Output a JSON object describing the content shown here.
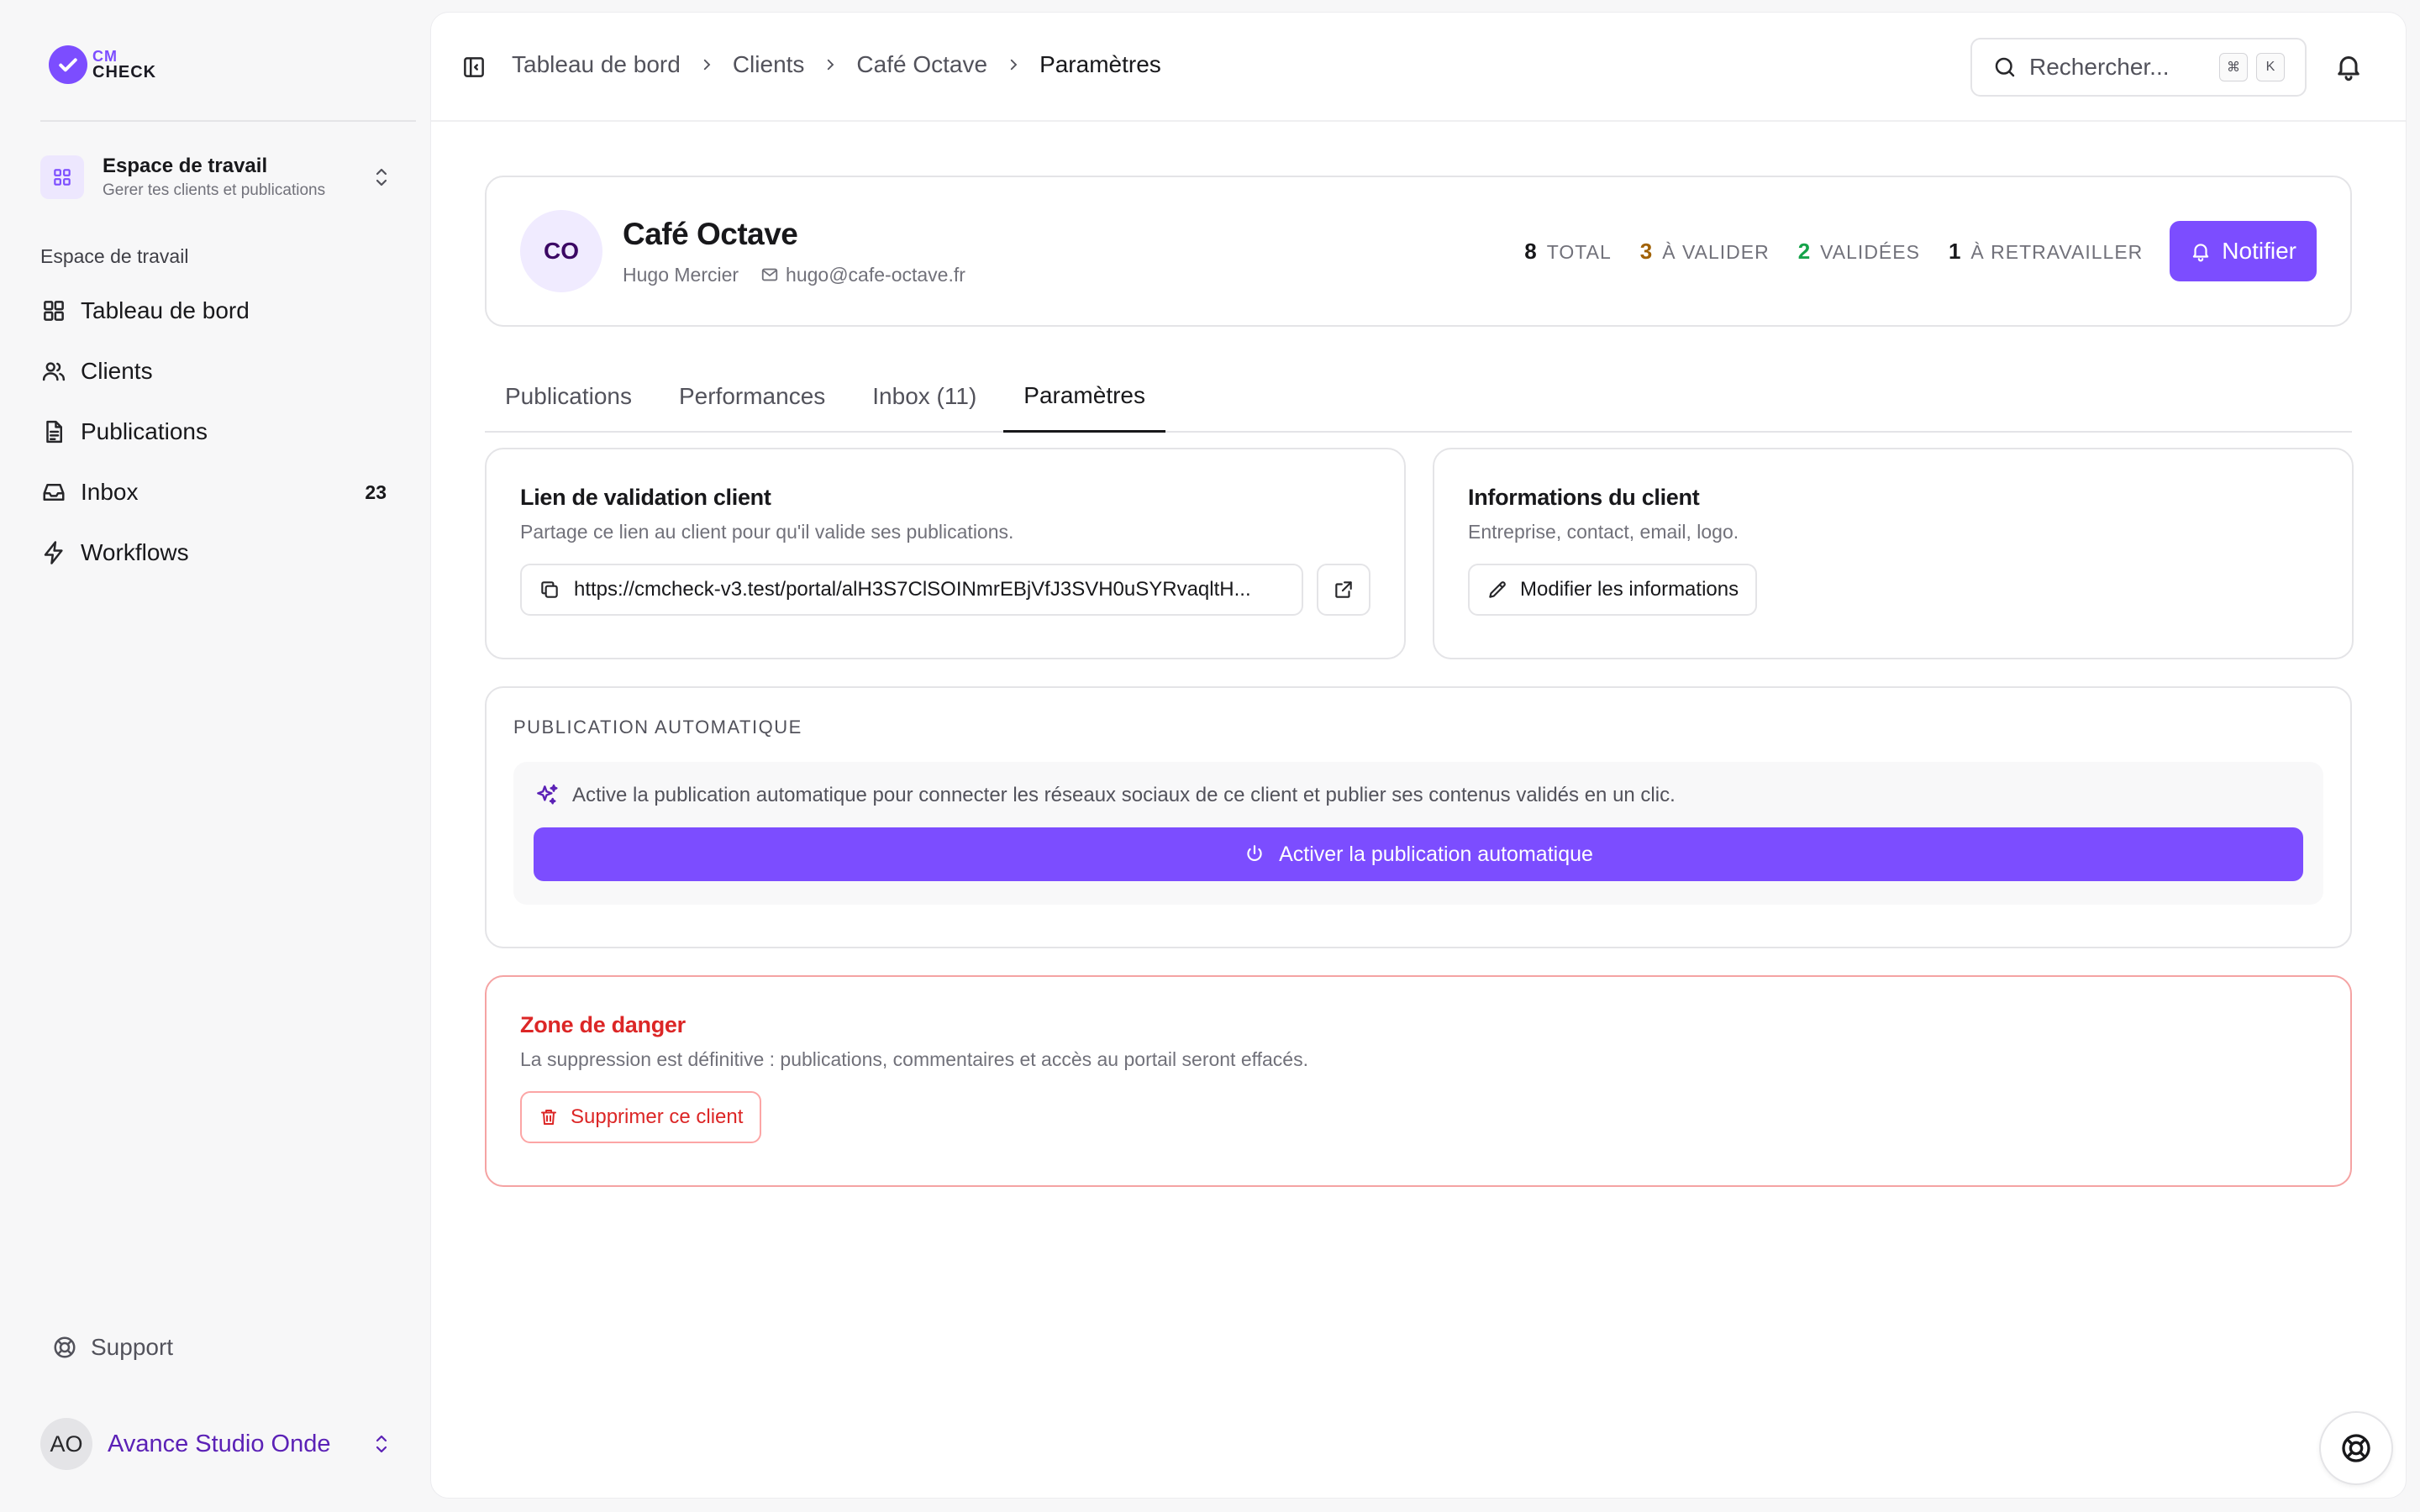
{
  "brand": {
    "line1": "CM",
    "line2": "CHECK",
    "accent": "#7c4dff"
  },
  "workspace": {
    "title": "Espace de travail",
    "subtitle": "Gerer tes clients et publications"
  },
  "sidebar": {
    "section_label": "Espace de travail",
    "items": [
      {
        "label": "Tableau de bord",
        "icon": "grid-icon"
      },
      {
        "label": "Clients",
        "icon": "users-icon"
      },
      {
        "label": "Publications",
        "icon": "document-icon"
      },
      {
        "label": "Inbox",
        "icon": "inbox-icon",
        "count": "23"
      },
      {
        "label": "Workflows",
        "icon": "lightning-icon"
      }
    ],
    "support_label": "Support"
  },
  "user": {
    "initials": "AO",
    "name": "Avance Studio Onde"
  },
  "breadcrumb": [
    "Tableau de bord",
    "Clients",
    "Café Octave",
    "Paramètres"
  ],
  "search": {
    "placeholder": "Rechercher...",
    "kbd1": "⌘",
    "kbd2": "K"
  },
  "client": {
    "initials": "CO",
    "name": "Café Octave",
    "contact": "Hugo Mercier",
    "email": "hugo@cafe-octave.fr",
    "stats": [
      {
        "num": "8",
        "label": "TOTAL",
        "color": "#18181b"
      },
      {
        "num": "3",
        "label": "À VALIDER",
        "color": "#a16207"
      },
      {
        "num": "2",
        "label": "VALIDÉES",
        "color": "#16a34a"
      },
      {
        "num": "1",
        "label": "À RETRAVAILLER",
        "color": "#18181b"
      }
    ],
    "notify_label": "Notifier"
  },
  "tabs": [
    {
      "label": "Publications",
      "active": false
    },
    {
      "label": "Performances",
      "active": false
    },
    {
      "label": "Inbox (11)",
      "active": false
    },
    {
      "label": "Paramètres",
      "active": true
    }
  ],
  "link_card": {
    "title": "Lien de validation client",
    "subtitle": "Partage ce lien au client pour qu'il valide ses publications.",
    "url": "https://cmcheck-v3.test/portal/alH3S7ClSOINmrEBjVfJ3SVH0uSYRvaqltH..."
  },
  "info_card": {
    "title": "Informations du client",
    "subtitle": "Entreprise, contact, email, logo.",
    "button": "Modifier les informations"
  },
  "auto_card": {
    "title": "PUBLICATION AUTOMATIQUE",
    "description": "Active la publication automatique pour connecter les réseaux sociaux de ce client et publier ses contenus validés en un clic.",
    "button": "Activer la publication automatique"
  },
  "danger_card": {
    "title": "Zone de danger",
    "subtitle": "La suppression est définitive : publications, commentaires et accès au portail seront effacés.",
    "button": "Supprimer ce client"
  }
}
